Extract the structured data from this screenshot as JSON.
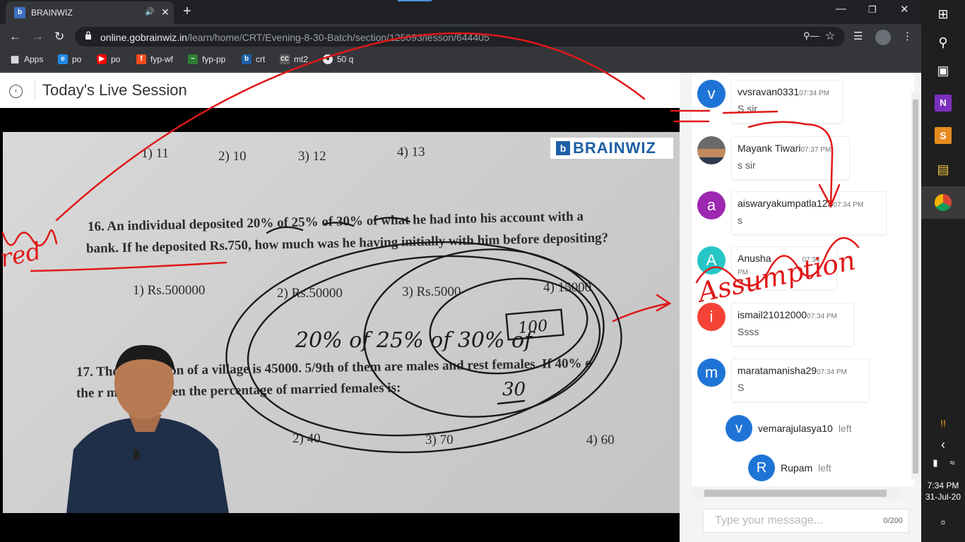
{
  "browser": {
    "tab_title": "BRAINWIZ",
    "tab_favicon": "b",
    "url_host": "online.gobrainwiz.in",
    "url_path": "/learn/home/CRT/Evening-8-30-Batch/section/125093/lesson/644405"
  },
  "bookmarks": [
    {
      "label": "Apps",
      "icon": "apps-grid-icon"
    },
    {
      "label": "po",
      "icon": "edge-icon"
    },
    {
      "label": "po",
      "icon": "youtube-icon"
    },
    {
      "label": "fyp-wf",
      "icon": "figma-icon"
    },
    {
      "label": "fyp-pp",
      "icon": "chart-icon"
    },
    {
      "label": "crt",
      "icon": "brainwiz-icon"
    },
    {
      "label": "mt2",
      "icon": "cc-icon"
    },
    {
      "label": "50 q",
      "icon": "globe-icon"
    }
  ],
  "session": {
    "title": "Today's Live Session"
  },
  "video": {
    "logo_text": "BRAINWIZ",
    "options_top": [
      "1) 11",
      "2) 10",
      "3) 12",
      "4) 13"
    ],
    "q16_line1": "16. An individual deposited 20% of 25% of 30% of what he had into his account with a",
    "q16_line2": "bank. If he deposited Rs.750, how much was he having initially with him before depositing?",
    "q16_options": [
      "1) Rs.500000",
      "2) Rs.50000",
      "3) Rs.5000",
      "4) 15000"
    ],
    "q17_line1": "17. The population of a village is 45000. 5/9th of them are males and rest females. If 40% o",
    "q17_line2": "the r      married, then the percentage of married females is:",
    "q17_options": [
      "2) 40",
      "3) 70",
      "4) 60"
    ],
    "handwriting_equation": "20% of 25% of 30% of",
    "handwriting_boxed": "100",
    "handwriting_answer": "30"
  },
  "chat": {
    "messages": [
      {
        "initial": "v",
        "color": "#1e74d6",
        "user": "vvsravan0331",
        "time": "07:34 PM",
        "text": "S sir"
      },
      {
        "initial": "",
        "color": "#7a5a3a",
        "user": "Mayank Tiwari",
        "time": "07:37 PM",
        "text": "s sir"
      },
      {
        "initial": "a",
        "color": "#9c27b0",
        "user": "aiswaryakumpatla123",
        "time": "07:34 PM",
        "text": "s"
      },
      {
        "initial": "A",
        "color": "#26c6c6",
        "user": "Anusha",
        "time": "07:34 PM",
        "text": ""
      },
      {
        "initial": "i",
        "color": "#f44336",
        "user": "ismail21012000",
        "time": "07:34 PM",
        "text": "Ssss"
      },
      {
        "initial": "m",
        "color": "#1e74d6",
        "user": "maratamanisha29",
        "time": "07:34 PM",
        "text": "S"
      }
    ],
    "left_events": [
      {
        "initial": "v",
        "color": "#1e74d6",
        "user": "vemarajulasya10",
        "status": "left"
      },
      {
        "initial": "R",
        "color": "#1e74d6",
        "user": "Rupam",
        "status": "left"
      }
    ],
    "input_placeholder": "Type your message...",
    "char_count": "0/200"
  },
  "taskbar": {
    "time": "7:34 PM",
    "date": "31-Jul-20"
  },
  "annotations": {
    "left_word": "red",
    "chat_word": "Assumption"
  }
}
